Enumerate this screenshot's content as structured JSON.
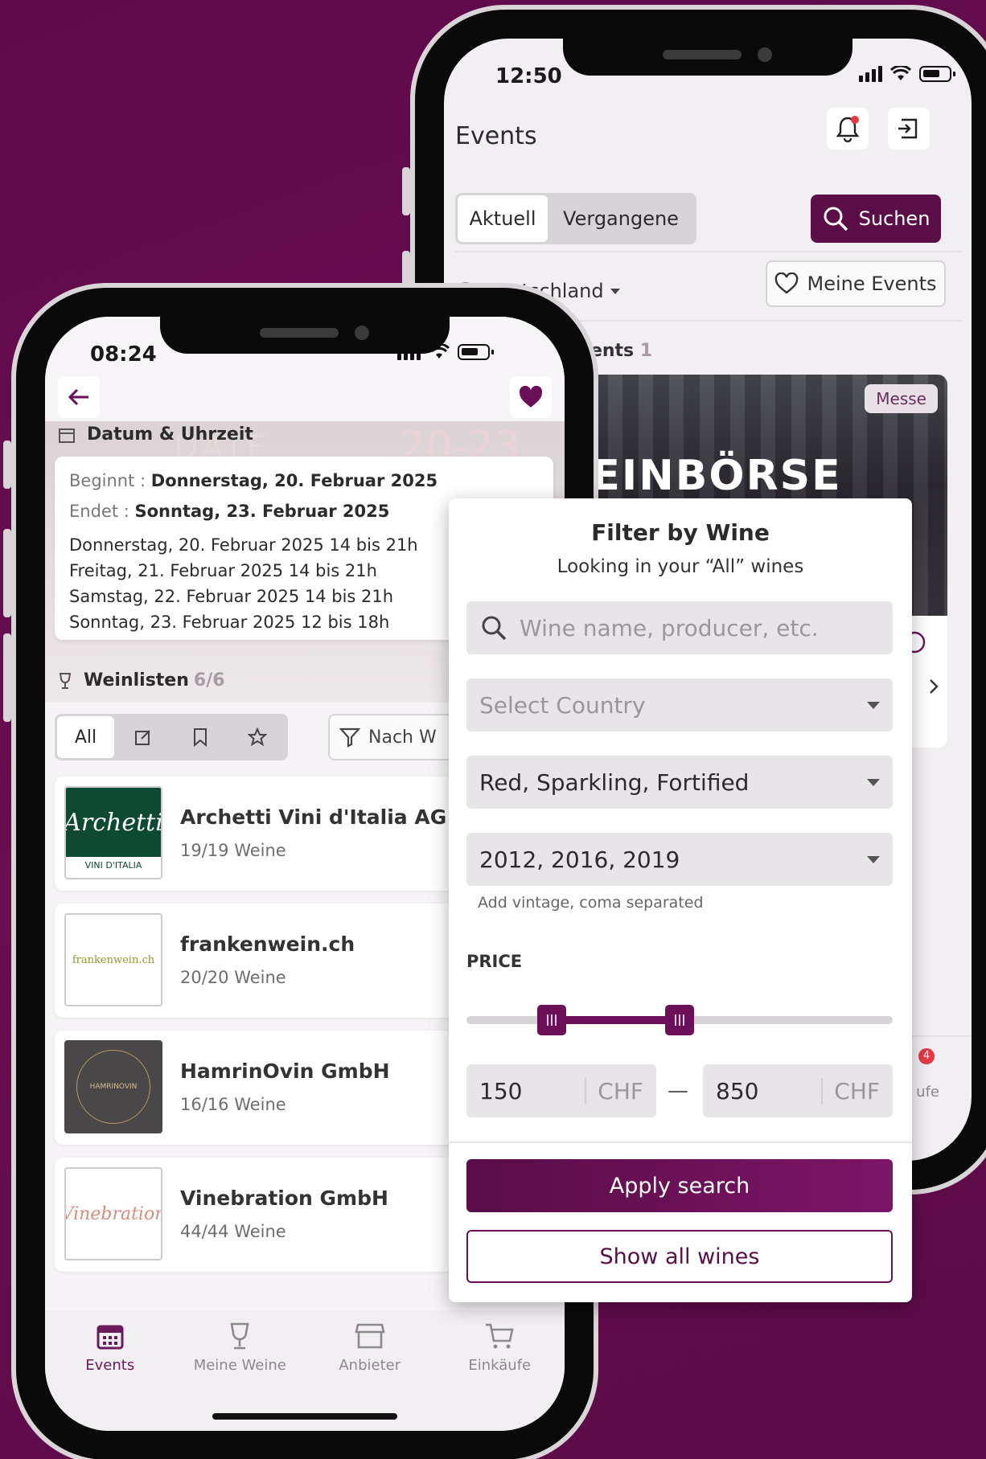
{
  "colors": {
    "brand": "#5b0d48",
    "background": "#62094d",
    "accent_badge": "#e63946"
  },
  "back_phone": {
    "status_time": "12:50",
    "header_title": "Events",
    "tabs": [
      "Aktuell",
      "Vergangene"
    ],
    "search_button": "Suchen",
    "country": "Deutschland",
    "my_events_button": "Meine Events",
    "events_label": "e Events",
    "events_count": "1",
    "event_badge": "Messe",
    "event_title_partial": "WEINBÖRSE 2025",
    "nav_partial": "ufe",
    "notification_count": "4"
  },
  "front_phone": {
    "status_time": "08:24",
    "section_date": "Datum & Uhrzeit",
    "starts_label": "Beginnt :",
    "starts_value": "Donnerstag, 20. Februar 2025",
    "ends_label": "Endet :",
    "ends_value": "Sonntag, 23. Februar 2025",
    "schedule": [
      "Donnerstag, 20. Februar 2025 14 bis 21h",
      "Freitag, 21. Februar 2025 14 bis 21h",
      "Samstag, 22. Februar 2025 14 bis 21h",
      "Sonntag, 23. Februar 2025 12 bis 18h"
    ],
    "section_lists": "Weinlisten",
    "lists_count": "6/6",
    "filter_tab_all": "All",
    "filter_button": "Nach W",
    "vendors": [
      {
        "name": "Archetti Vini d'Italia AG",
        "sub": "19/19 Weine",
        "logo_text": "VINI D'ITALIA"
      },
      {
        "name": "frankenwein.ch",
        "sub": "20/20 Weine",
        "logo_text": "frankenwein.ch"
      },
      {
        "name": "HamrinOvin GmbH",
        "sub": "16/16 Weine",
        "logo_text": "HAMRINOVIN"
      },
      {
        "name": "Vinebration GmbH",
        "sub": "44/44 Weine",
        "logo_text": "Vinebration"
      }
    ],
    "nav": [
      "Events",
      "Meine Weine",
      "Anbieter",
      "Einkäufe"
    ]
  },
  "filter_modal": {
    "title": "Filter by Wine",
    "subtitle": "Looking in your “All” wines",
    "search_placeholder": "Wine name, producer, etc.",
    "country_placeholder": "Select Country",
    "types_value": "Red, Sparkling, Fortified",
    "vintage_value": "2012, 2016, 2019",
    "vintage_help": "Add vintage, coma separated",
    "price_label": "PRICE",
    "price_min": "150",
    "price_max": "850",
    "currency": "CHF",
    "range_dash": "—",
    "slider_min_fraction": 0.2,
    "slider_max_fraction": 0.5,
    "apply_button": "Apply search",
    "show_all_button": "Show all wines"
  }
}
